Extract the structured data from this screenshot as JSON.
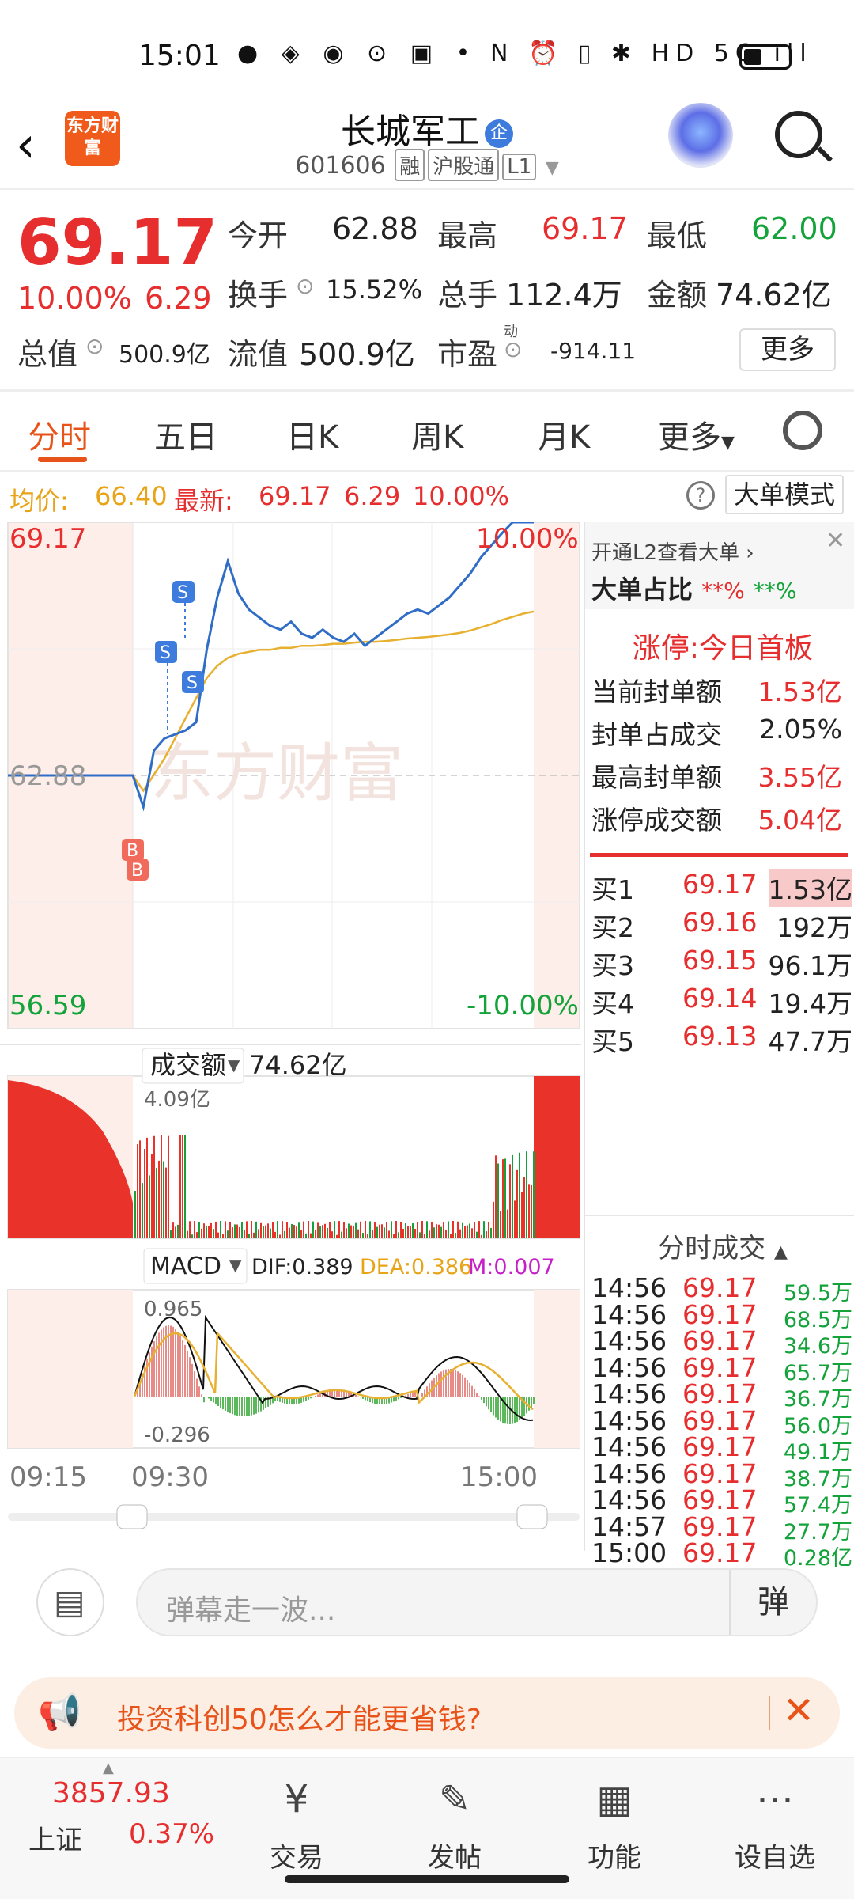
{
  "status_bar": {
    "time": "15:01",
    "app_icons": "● ◈ ◉ ⊙ ▣ •",
    "sys_icons": "N ⏰ ▯ ✱ HD 5G ıll"
  },
  "header": {
    "logo_text": "东方财富",
    "stock_name": "长城军工",
    "badge": "企",
    "code": "601606",
    "tags": [
      "融",
      "沪股通",
      "L1"
    ]
  },
  "quote": {
    "price": "69.17",
    "change_pct": "10.00%",
    "change": "6.29",
    "open_label": "今开",
    "open": "62.88",
    "high_label": "最高",
    "high": "69.17",
    "low_label": "最低",
    "low": "62.00",
    "turnover_label": "换手",
    "turnover": "15.52%",
    "volume_label": "总手",
    "volume": "112.4万",
    "amount_label": "金额",
    "amount": "74.62亿",
    "mcap_label": "总值",
    "mcap": "500.9亿",
    "float_label": "流值",
    "float_val": "500.9亿",
    "pe_label": "市盈",
    "pe_sup": "动",
    "pe": "-914.11",
    "more": "更多"
  },
  "tabs": [
    "分时",
    "五日",
    "日K",
    "周K",
    "月K",
    "更多"
  ],
  "info": {
    "avg_label": "均价:",
    "avg": "66.40",
    "latest_label": "最新:",
    "latest": "69.17",
    "latest_chg": "6.29",
    "latest_pct": "10.00%",
    "mode_button": "大单模式"
  },
  "chart": {
    "top_price": "69.17",
    "top_pct": "10.00%",
    "mid_price": "62.88",
    "bottom_price": "56.59",
    "bottom_pct": "-10.00%",
    "watermark": "东方财富",
    "vol_label": "成交额",
    "vol_total": "74.62亿",
    "vol_max": "4.09亿",
    "macd_label": "MACD",
    "dif": "DIF:0.389",
    "dea": "DEA:0.386",
    "m": "M:0.007",
    "macd_max": "0.965",
    "macd_min": "-0.296",
    "time_labels": [
      "09:15",
      "09:30",
      "15:00"
    ],
    "price_line": [
      62.88,
      62.88,
      62.88,
      62.1,
      63.5,
      63.8,
      63.9,
      64.0,
      64.2,
      66.0,
      67.3,
      68.2,
      67.4,
      67.0,
      66.8,
      66.6,
      66.5,
      66.7,
      66.4,
      66.3,
      66.5,
      66.3,
      66.2,
      66.4,
      66.1,
      66.3,
      66.5,
      66.7,
      66.9,
      67.0,
      66.9,
      67.1,
      67.3,
      67.6,
      67.9,
      68.3,
      68.6,
      68.9,
      69.17,
      69.17,
      69.17
    ],
    "avg_line": [
      62.88,
      62.88,
      62.88,
      62.5,
      62.9,
      63.3,
      63.8,
      64.3,
      64.8,
      65.3,
      65.6,
      65.8,
      65.9,
      65.95,
      66.0,
      66.0,
      66.05,
      66.05,
      66.1,
      66.1,
      66.12,
      66.15,
      66.15,
      66.18,
      66.2,
      66.2,
      66.22,
      66.25,
      66.28,
      66.3,
      66.32,
      66.35,
      66.38,
      66.42,
      66.48,
      66.56,
      66.64,
      66.74,
      66.82,
      66.9,
      66.95
    ]
  },
  "right_panel": {
    "l2_hint": "开通L2查看大单",
    "big_ratio_label": "大单占比",
    "big_ratio_buy": "**%",
    "big_ratio_sell": "**%",
    "limit_title": "涨停:今日首板",
    "limit_rows": [
      {
        "label": "当前封单额",
        "value": "1.53亿"
      },
      {
        "label": "封单占成交",
        "value": "2.05%"
      },
      {
        "label": "最高封单额",
        "value": "3.55亿"
      },
      {
        "label": "涨停成交额",
        "value": "5.04亿"
      }
    ],
    "bids": [
      {
        "label": "买1",
        "price": "69.17",
        "amt": "1.53亿"
      },
      {
        "label": "买2",
        "price": "69.16",
        "amt": "192万"
      },
      {
        "label": "买3",
        "price": "69.15",
        "amt": "96.1万"
      },
      {
        "label": "买4",
        "price": "69.14",
        "amt": "19.4万"
      },
      {
        "label": "买5",
        "price": "69.13",
        "amt": "47.7万"
      }
    ],
    "trades_title": "分时成交",
    "trades": [
      {
        "time": "14:56",
        "price": "69.17",
        "amt": "59.5万"
      },
      {
        "time": "14:56",
        "price": "69.17",
        "amt": "68.5万"
      },
      {
        "time": "14:56",
        "price": "69.17",
        "amt": "34.6万"
      },
      {
        "time": "14:56",
        "price": "69.17",
        "amt": "65.7万"
      },
      {
        "time": "14:56",
        "price": "69.17",
        "amt": "36.7万"
      },
      {
        "time": "14:56",
        "price": "69.17",
        "amt": "56.0万"
      },
      {
        "time": "14:56",
        "price": "69.17",
        "amt": "49.1万"
      },
      {
        "time": "14:56",
        "price": "69.17",
        "amt": "38.7万"
      },
      {
        "time": "14:56",
        "price": "69.17",
        "amt": "57.4万"
      },
      {
        "time": "14:57",
        "price": "69.17",
        "amt": "27.7万"
      },
      {
        "time": "15:00",
        "price": "69.17",
        "amt": "0.28亿"
      }
    ]
  },
  "comment": {
    "placeholder": "弹幕走一波...",
    "dan": "弹"
  },
  "promo": {
    "text": "投资科创50怎么才能更省钱?"
  },
  "bottom": {
    "index_value": "3857.93",
    "index_name": "上证",
    "index_pct": "0.37%",
    "items": [
      {
        "label": "交易",
        "icon": "¥"
      },
      {
        "label": "发帖",
        "icon": "✎"
      },
      {
        "label": "功能",
        "icon": "▦"
      },
      {
        "label": "设自选",
        "icon": "⋯"
      }
    ]
  },
  "colors": {
    "up": "#e62e2e",
    "down": "#14a33a",
    "avg": "#e8a317",
    "price": "#2f6dc7",
    "accent": "#e8531a"
  }
}
